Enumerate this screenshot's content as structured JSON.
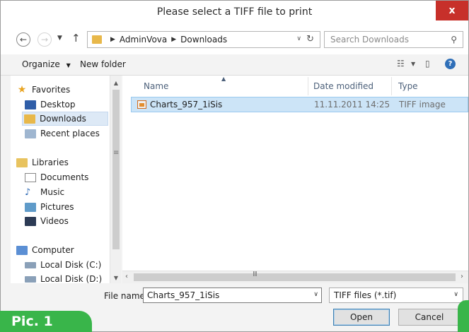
{
  "window": {
    "title": "Please select a TIFF file to print",
    "close_label": "x"
  },
  "nav": {
    "back_glyph": "←",
    "forward_glyph": "→",
    "recent_dropdown_glyph": "▼",
    "up_glyph": "↑",
    "path": [
      "AdminVova",
      "Downloads"
    ],
    "search_placeholder": "Search Downloads"
  },
  "toolbar": {
    "organize_label": "Organize",
    "new_folder_label": "New folder"
  },
  "sidebar": {
    "items": [
      {
        "label": "Favorites",
        "icon": "star-icon"
      },
      {
        "label": "Desktop",
        "icon": "desktop-icon"
      },
      {
        "label": "Downloads",
        "icon": "downloads-folder-icon",
        "selected": true
      },
      {
        "label": "Recent places",
        "icon": "recent-places-icon"
      },
      {
        "label": "Libraries",
        "icon": "libraries-icon"
      },
      {
        "label": "Documents",
        "icon": "documents-icon"
      },
      {
        "label": "Music",
        "icon": "music-icon"
      },
      {
        "label": "Pictures",
        "icon": "pictures-icon"
      },
      {
        "label": "Videos",
        "icon": "videos-icon"
      },
      {
        "label": "Computer",
        "icon": "computer-icon"
      },
      {
        "label": "Local Disk (C:)",
        "icon": "disk-icon"
      },
      {
        "label": "Local Disk (D:)",
        "icon": "disk-icon"
      }
    ]
  },
  "filelist": {
    "columns": [
      "Name",
      "Date modified",
      "Type"
    ],
    "rows": [
      {
        "name": "Charts_957_1iSis",
        "date": "11.11.2011 14:25",
        "type": "TIFF image",
        "selected": true
      }
    ]
  },
  "bottom": {
    "filename_label": "File name:",
    "filename_value": "Charts_957_1iSis",
    "filetype_value": "TIFF files (*.tif)",
    "open_label": "Open",
    "cancel_label": "Cancel"
  },
  "caption": "Pic. 1",
  "colors": {
    "accent_green": "#39b54a",
    "selection": "#cce4f7",
    "close_red": "#c7302a"
  }
}
